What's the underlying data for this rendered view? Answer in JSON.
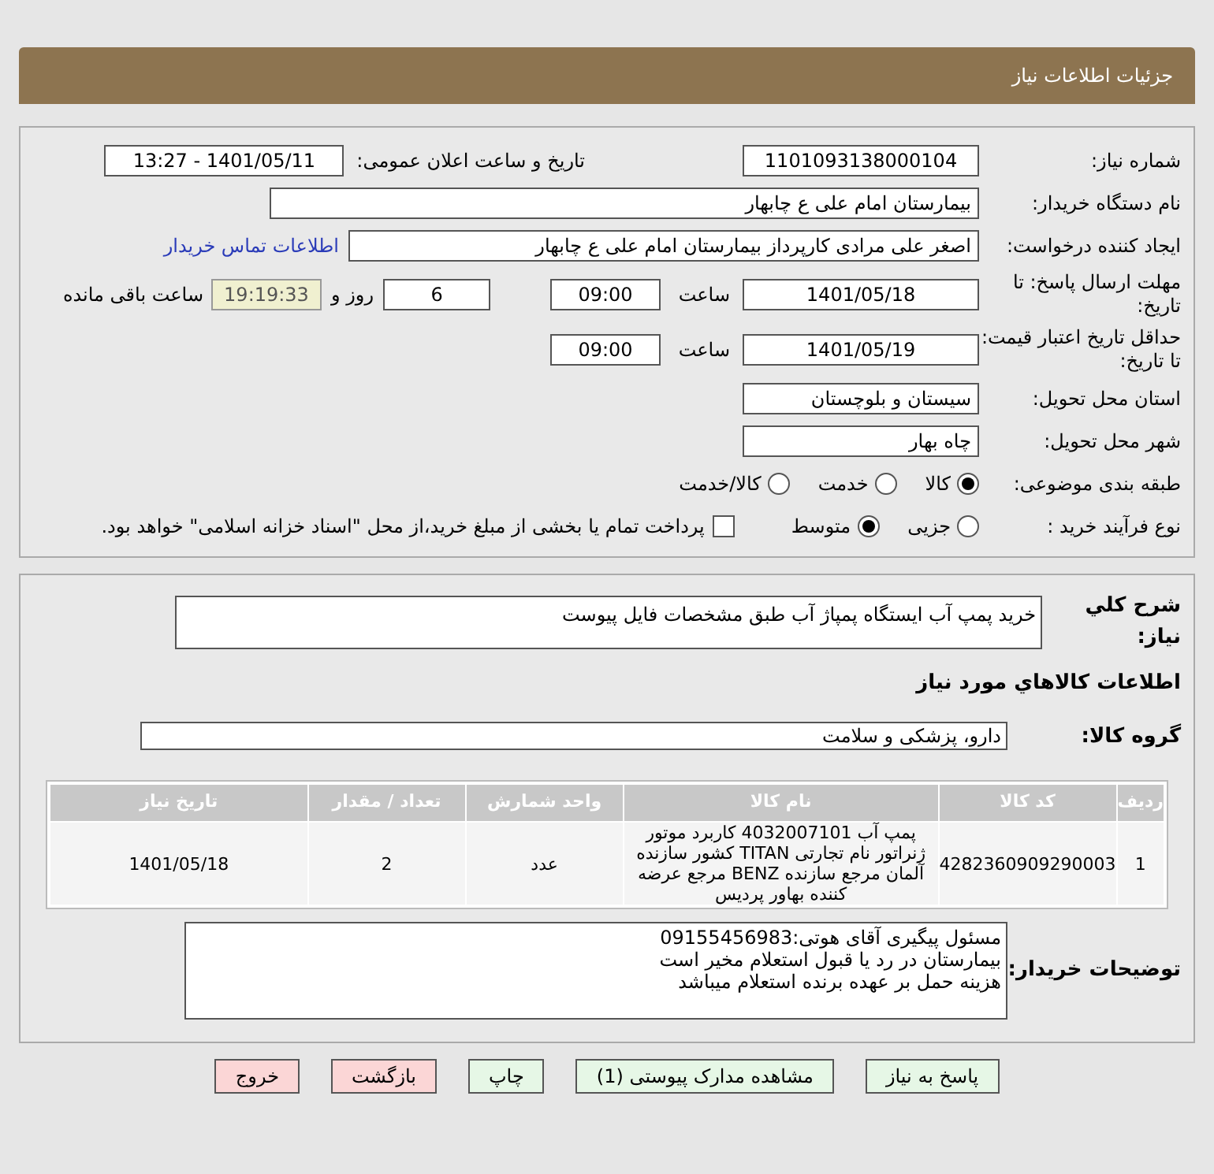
{
  "header": {
    "title": "جزئیات اطلاعات نیاز"
  },
  "need_number": {
    "label": "شماره نیاز:",
    "value": "1101093138000104"
  },
  "announce": {
    "label": "تاریخ و ساعت اعلان عمومی:",
    "value": "1401/05/11 - 13:27"
  },
  "buyer": {
    "label": "نام دستگاه خریدار:",
    "value": "بیمارستان امام علی  ع  چابهار"
  },
  "requester": {
    "label": "ایجاد کننده درخواست:",
    "value": "اصغر علی مرادی کارپرداز بیمارستان امام علی  ع  چابهار",
    "link": "اطلاعات تماس خریدار"
  },
  "reply_deadline": {
    "label": "مهلت ارسال پاسخ: تا تاریخ:",
    "date": "1401/05/18",
    "time_label": "ساعت",
    "time": "09:00",
    "days": "6",
    "days_label": "روز و",
    "remaining": "19:19:33",
    "remaining_label": "ساعت باقی مانده"
  },
  "validity": {
    "label": "حداقل تاریخ اعتبار قیمت: تا تاریخ:",
    "date": "1401/05/19",
    "time_label": "ساعت",
    "time": "09:00"
  },
  "province": {
    "label": "استان محل تحویل:",
    "value": "سیستان و بلوچستان"
  },
  "city": {
    "label": "شهر محل تحویل:",
    "value": "چاه بهار"
  },
  "category": {
    "label": "طبقه بندی موضوعی:",
    "options": [
      {
        "label": "کالا",
        "selected": true
      },
      {
        "label": "خدمت",
        "selected": false
      },
      {
        "label": "کالا/خدمت",
        "selected": false
      }
    ]
  },
  "process": {
    "label": "نوع فرآیند خرید :",
    "options": [
      {
        "label": "جزیی",
        "selected": false
      },
      {
        "label": "متوسط",
        "selected": true
      }
    ],
    "payment": {
      "label": "پرداخت تمام یا بخشی از مبلغ خرید،از محل \"اسناد خزانه اسلامی\" خواهد بود.",
      "checked": false
    }
  },
  "description": {
    "label": "شرح کلي نياز:",
    "value": "خرید پمپ آب ایستگاه پمپاژ آب طبق مشخصات فایل پیوست"
  },
  "goods_title": "اطلاعات کالاهاي مورد نياز",
  "goods_group": {
    "label": "گروه کالا:",
    "value": "دارو، پزشکی و سلامت"
  },
  "table": {
    "columns": [
      "ردیف",
      "کد کالا",
      "نام کالا",
      "واحد شمارش",
      "تعداد / مقدار",
      "تاریخ نیاز"
    ],
    "rows": [
      [
        "1",
        "4282360909290003",
        "پمپ آب 4032007101 کاربرد موتور ژنراتور نام تجارتی TITAN کشور سازنده آلمان مرجع سازنده BENZ مرجع عرضه کننده بهاور پردیس",
        "عدد",
        "2",
        "1401/05/18"
      ]
    ]
  },
  "buyer_notes": {
    "label": "توضیحات خریدار:",
    "lines": [
      "مسئول پیگیری آقای هوتی:09155456983",
      "بیمارستان در رد یا قبول استعلام مخیر است",
      "هزینه حمل بر عهده برنده استعلام میباشد"
    ]
  },
  "buttons": [
    {
      "label": "پاسخ به نیاز",
      "kind": "normal"
    },
    {
      "label": "مشاهده مدارک پیوستی (1)",
      "kind": "normal"
    },
    {
      "label": "چاپ",
      "kind": "normal"
    },
    {
      "label": "بازگشت",
      "kind": "danger"
    },
    {
      "label": "خروج",
      "kind": "danger"
    }
  ]
}
